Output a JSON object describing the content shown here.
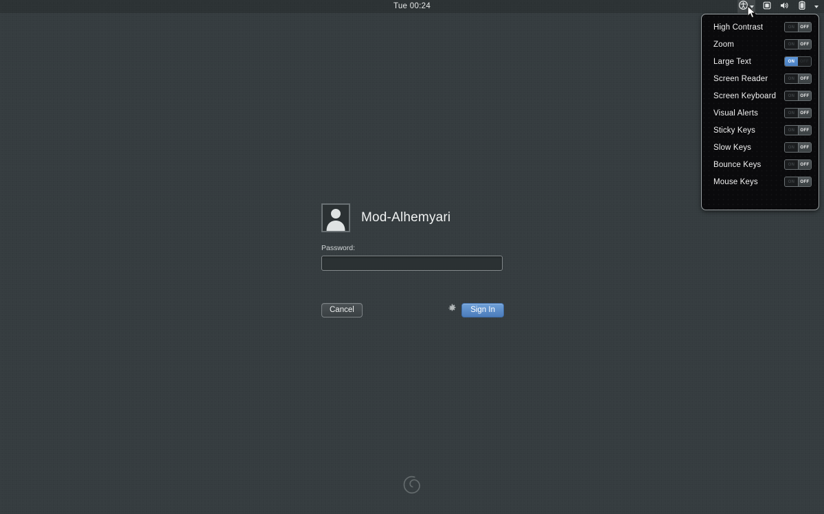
{
  "top_panel": {
    "clock": "Tue 00:24",
    "tray": [
      {
        "name": "accessibility-icon",
        "label": "Accessibility"
      },
      {
        "name": "chevron-down-icon",
        "label": ""
      },
      {
        "name": "display-icon",
        "label": "Display"
      },
      {
        "name": "volume-icon",
        "label": "Volume"
      },
      {
        "name": "battery-icon",
        "label": "Battery"
      },
      {
        "name": "system-menu-chevron-icon",
        "label": ""
      }
    ]
  },
  "a11y_menu": {
    "items": [
      {
        "label": "High Contrast",
        "state": "OFF",
        "on_text": "ON",
        "off_text": "OFF"
      },
      {
        "label": "Zoom",
        "state": "OFF",
        "on_text": "ON",
        "off_text": "OFF"
      },
      {
        "label": "Large Text",
        "state": "ON",
        "on_text": "ON",
        "off_text": "OFF"
      },
      {
        "label": "Screen Reader",
        "state": "OFF",
        "on_text": "ON",
        "off_text": "OFF"
      },
      {
        "label": "Screen Keyboard",
        "state": "OFF",
        "on_text": "ON",
        "off_text": "OFF"
      },
      {
        "label": "Visual Alerts",
        "state": "OFF",
        "on_text": "ON",
        "off_text": "OFF"
      },
      {
        "label": "Sticky Keys",
        "state": "OFF",
        "on_text": "ON",
        "off_text": "OFF"
      },
      {
        "label": "Slow Keys",
        "state": "OFF",
        "on_text": "ON",
        "off_text": "OFF"
      },
      {
        "label": "Bounce Keys",
        "state": "OFF",
        "on_text": "ON",
        "off_text": "OFF"
      },
      {
        "label": "Mouse Keys",
        "state": "OFF",
        "on_text": "ON",
        "off_text": "OFF"
      }
    ]
  },
  "login": {
    "username": "Mod-Alhemyari",
    "password_label": "Password:",
    "password_value": "",
    "password_placeholder": "",
    "cancel_label": "Cancel",
    "signin_label": "Sign In",
    "session_icon": "gear-icon",
    "avatar_icon": "default-user-avatar-icon"
  },
  "branding": {
    "logo_icon": "debian-swirl-logo"
  },
  "colors": {
    "background": "#353c3f",
    "panel_background": "#0a0a0c",
    "panel_border": "#9aa0a2",
    "accent_blue": "#4b7cbb",
    "toggle_on_blue": "#5f97d8",
    "text_primary": "#f0f2f2"
  }
}
